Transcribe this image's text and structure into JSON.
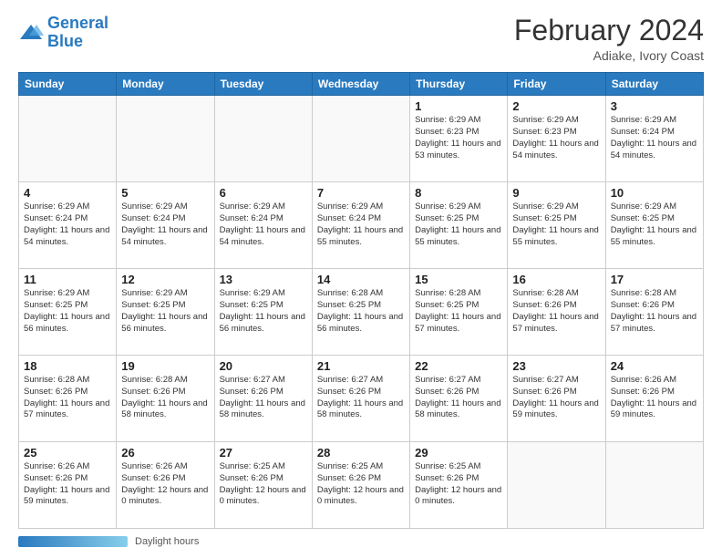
{
  "logo": {
    "line1": "General",
    "line2": "Blue"
  },
  "header": {
    "title": "February 2024",
    "subtitle": "Adiake, Ivory Coast"
  },
  "days_of_week": [
    "Sunday",
    "Monday",
    "Tuesday",
    "Wednesday",
    "Thursday",
    "Friday",
    "Saturday"
  ],
  "weeks": [
    [
      {
        "day": "",
        "sunrise": "",
        "sunset": "",
        "daylight": ""
      },
      {
        "day": "",
        "sunrise": "",
        "sunset": "",
        "daylight": ""
      },
      {
        "day": "",
        "sunrise": "",
        "sunset": "",
        "daylight": ""
      },
      {
        "day": "",
        "sunrise": "",
        "sunset": "",
        "daylight": ""
      },
      {
        "day": "1",
        "sunrise": "Sunrise: 6:29 AM",
        "sunset": "Sunset: 6:23 PM",
        "daylight": "Daylight: 11 hours and 53 minutes."
      },
      {
        "day": "2",
        "sunrise": "Sunrise: 6:29 AM",
        "sunset": "Sunset: 6:23 PM",
        "daylight": "Daylight: 11 hours and 54 minutes."
      },
      {
        "day": "3",
        "sunrise": "Sunrise: 6:29 AM",
        "sunset": "Sunset: 6:24 PM",
        "daylight": "Daylight: 11 hours and 54 minutes."
      }
    ],
    [
      {
        "day": "4",
        "sunrise": "Sunrise: 6:29 AM",
        "sunset": "Sunset: 6:24 PM",
        "daylight": "Daylight: 11 hours and 54 minutes."
      },
      {
        "day": "5",
        "sunrise": "Sunrise: 6:29 AM",
        "sunset": "Sunset: 6:24 PM",
        "daylight": "Daylight: 11 hours and 54 minutes."
      },
      {
        "day": "6",
        "sunrise": "Sunrise: 6:29 AM",
        "sunset": "Sunset: 6:24 PM",
        "daylight": "Daylight: 11 hours and 54 minutes."
      },
      {
        "day": "7",
        "sunrise": "Sunrise: 6:29 AM",
        "sunset": "Sunset: 6:24 PM",
        "daylight": "Daylight: 11 hours and 55 minutes."
      },
      {
        "day": "8",
        "sunrise": "Sunrise: 6:29 AM",
        "sunset": "Sunset: 6:25 PM",
        "daylight": "Daylight: 11 hours and 55 minutes."
      },
      {
        "day": "9",
        "sunrise": "Sunrise: 6:29 AM",
        "sunset": "Sunset: 6:25 PM",
        "daylight": "Daylight: 11 hours and 55 minutes."
      },
      {
        "day": "10",
        "sunrise": "Sunrise: 6:29 AM",
        "sunset": "Sunset: 6:25 PM",
        "daylight": "Daylight: 11 hours and 55 minutes."
      }
    ],
    [
      {
        "day": "11",
        "sunrise": "Sunrise: 6:29 AM",
        "sunset": "Sunset: 6:25 PM",
        "daylight": "Daylight: 11 hours and 56 minutes."
      },
      {
        "day": "12",
        "sunrise": "Sunrise: 6:29 AM",
        "sunset": "Sunset: 6:25 PM",
        "daylight": "Daylight: 11 hours and 56 minutes."
      },
      {
        "day": "13",
        "sunrise": "Sunrise: 6:29 AM",
        "sunset": "Sunset: 6:25 PM",
        "daylight": "Daylight: 11 hours and 56 minutes."
      },
      {
        "day": "14",
        "sunrise": "Sunrise: 6:28 AM",
        "sunset": "Sunset: 6:25 PM",
        "daylight": "Daylight: 11 hours and 56 minutes."
      },
      {
        "day": "15",
        "sunrise": "Sunrise: 6:28 AM",
        "sunset": "Sunset: 6:25 PM",
        "daylight": "Daylight: 11 hours and 57 minutes."
      },
      {
        "day": "16",
        "sunrise": "Sunrise: 6:28 AM",
        "sunset": "Sunset: 6:26 PM",
        "daylight": "Daylight: 11 hours and 57 minutes."
      },
      {
        "day": "17",
        "sunrise": "Sunrise: 6:28 AM",
        "sunset": "Sunset: 6:26 PM",
        "daylight": "Daylight: 11 hours and 57 minutes."
      }
    ],
    [
      {
        "day": "18",
        "sunrise": "Sunrise: 6:28 AM",
        "sunset": "Sunset: 6:26 PM",
        "daylight": "Daylight: 11 hours and 57 minutes."
      },
      {
        "day": "19",
        "sunrise": "Sunrise: 6:28 AM",
        "sunset": "Sunset: 6:26 PM",
        "daylight": "Daylight: 11 hours and 58 minutes."
      },
      {
        "day": "20",
        "sunrise": "Sunrise: 6:27 AM",
        "sunset": "Sunset: 6:26 PM",
        "daylight": "Daylight: 11 hours and 58 minutes."
      },
      {
        "day": "21",
        "sunrise": "Sunrise: 6:27 AM",
        "sunset": "Sunset: 6:26 PM",
        "daylight": "Daylight: 11 hours and 58 minutes."
      },
      {
        "day": "22",
        "sunrise": "Sunrise: 6:27 AM",
        "sunset": "Sunset: 6:26 PM",
        "daylight": "Daylight: 11 hours and 58 minutes."
      },
      {
        "day": "23",
        "sunrise": "Sunrise: 6:27 AM",
        "sunset": "Sunset: 6:26 PM",
        "daylight": "Daylight: 11 hours and 59 minutes."
      },
      {
        "day": "24",
        "sunrise": "Sunrise: 6:26 AM",
        "sunset": "Sunset: 6:26 PM",
        "daylight": "Daylight: 11 hours and 59 minutes."
      }
    ],
    [
      {
        "day": "25",
        "sunrise": "Sunrise: 6:26 AM",
        "sunset": "Sunset: 6:26 PM",
        "daylight": "Daylight: 11 hours and 59 minutes."
      },
      {
        "day": "26",
        "sunrise": "Sunrise: 6:26 AM",
        "sunset": "Sunset: 6:26 PM",
        "daylight": "Daylight: 12 hours and 0 minutes."
      },
      {
        "day": "27",
        "sunrise": "Sunrise: 6:25 AM",
        "sunset": "Sunset: 6:26 PM",
        "daylight": "Daylight: 12 hours and 0 minutes."
      },
      {
        "day": "28",
        "sunrise": "Sunrise: 6:25 AM",
        "sunset": "Sunset: 6:26 PM",
        "daylight": "Daylight: 12 hours and 0 minutes."
      },
      {
        "day": "29",
        "sunrise": "Sunrise: 6:25 AM",
        "sunset": "Sunset: 6:26 PM",
        "daylight": "Daylight: 12 hours and 0 minutes."
      },
      {
        "day": "",
        "sunrise": "",
        "sunset": "",
        "daylight": ""
      },
      {
        "day": "",
        "sunrise": "",
        "sunset": "",
        "daylight": ""
      }
    ]
  ],
  "footer": {
    "label": "Daylight hours"
  }
}
